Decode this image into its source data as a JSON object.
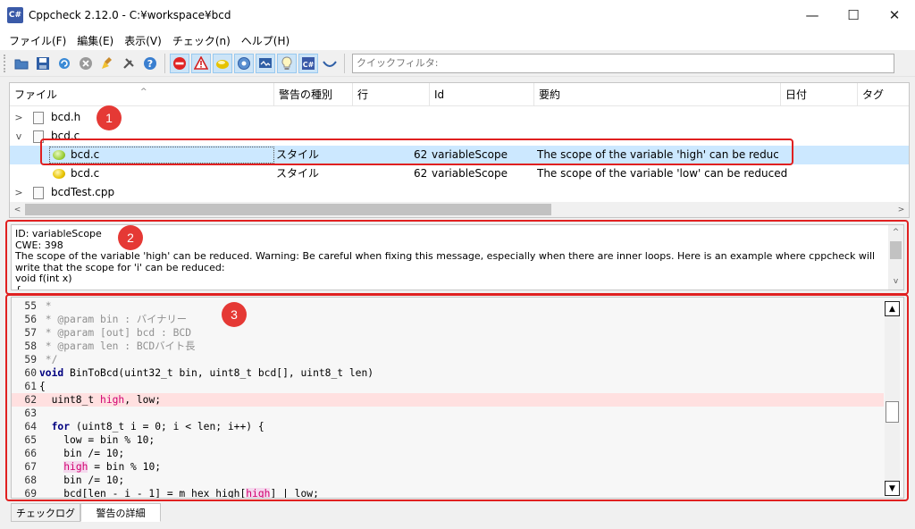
{
  "window": {
    "title": "Cppcheck 2.12.0 - C:¥workspace¥bcd",
    "app_icon": "C#",
    "controls": {
      "minimize": "—",
      "maximize": "☐",
      "close": "✕"
    }
  },
  "menu": [
    "ファイル(F)",
    "編集(E)",
    "表示(V)",
    "チェック(n)",
    "ヘルプ(H)"
  ],
  "toolbar": {
    "icons": [
      "open-icon",
      "save-icon",
      "reload-icon",
      "stop-icon",
      "clean-icon",
      "settings-icon",
      "help-icon",
      "error-icon",
      "warning-icon",
      "style-icon",
      "performance-icon",
      "portability-icon",
      "information-icon",
      "cppcheck-icon",
      "c-standard-icon"
    ],
    "quick_filter_placeholder": "クイックフィルタ:"
  },
  "results": {
    "columns": [
      "ファイル",
      "警告の種別",
      "行",
      "Id",
      "要約",
      "日付",
      "タグ"
    ],
    "sort_indicator": "^",
    "rows": [
      {
        "file": "bcd.h",
        "expander": ">",
        "level": 0
      },
      {
        "file": "bcd.c",
        "expander": "v",
        "level": 0
      },
      {
        "file": "bcd.c",
        "type": "スタイル",
        "line": "62",
        "id": "variableScope",
        "summary": "The scope of the variable 'high' can be reduc...",
        "level": 1,
        "selected": true,
        "icon": "style-green"
      },
      {
        "file": "bcd.c",
        "type": "スタイル",
        "line": "62",
        "id": "variableScope",
        "summary": "The scope of the variable 'low' can be reduced.",
        "level": 1,
        "icon": "style-yellow"
      },
      {
        "file": "bcdTest.cpp",
        "expander": ">",
        "level": 0
      }
    ]
  },
  "detail": {
    "lines": [
      "ID: variableScope",
      "CWE: 398",
      "The scope of the variable 'high' can be reduced. Warning: Be careful when fixing this message, especially when there are inner loops. Here is an example where cppcheck will write that the scope for 'i' can be reduced:",
      "void f(int x)",
      "{"
    ]
  },
  "code": {
    "lines": [
      {
        "n": "55",
        "text": " *"
      },
      {
        "n": "56",
        "text": " * @param bin : バイナリー"
      },
      {
        "n": "57",
        "text": " * @param [out] bcd : BCD"
      },
      {
        "n": "58",
        "text": " * @param len : BCDバイト長"
      },
      {
        "n": "59",
        "text": " */"
      },
      {
        "n": "60",
        "text": "void BinToBcd(uint32_t bin, uint8_t bcd[], uint8_t len)"
      },
      {
        "n": "61",
        "text": "{"
      },
      {
        "n": "62",
        "text": "  uint8_t high, low;"
      },
      {
        "n": "63",
        "text": ""
      },
      {
        "n": "64",
        "text": "  for (uint8_t i = 0; i < len; i++) {"
      },
      {
        "n": "65",
        "text": "    low = bin % 10;"
      },
      {
        "n": "66",
        "text": "    bin /= 10;"
      },
      {
        "n": "67",
        "text": "    high = bin % 10;"
      },
      {
        "n": "68",
        "text": "    bin /= 10;"
      },
      {
        "n": "69",
        "text": "    bcd[len - i - 1] = m_hex_high[high] | low;"
      }
    ]
  },
  "tabs": [
    "チェックログ",
    "警告の詳細"
  ],
  "annotations": [
    "1",
    "2",
    "3"
  ],
  "colors": {
    "annotation": "#e02020",
    "selection": "#cce8ff",
    "highlight_line": "#ffe0e0"
  }
}
